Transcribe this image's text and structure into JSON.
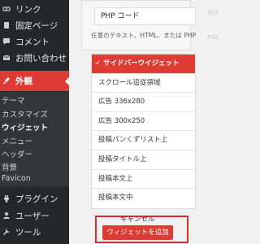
{
  "sidebar": {
    "items": [
      {
        "label": "リンク",
        "icon": "link-icon"
      },
      {
        "label": "固定ページ",
        "icon": "page-icon"
      },
      {
        "label": "コメント",
        "icon": "comment-icon"
      },
      {
        "label": "お問い合わせ",
        "icon": "mail-icon"
      },
      {
        "label": "外観",
        "icon": "brush-icon",
        "active": true
      },
      {
        "label": "プラグイン",
        "icon": "plugin-icon"
      },
      {
        "label": "ユーザー",
        "icon": "user-icon"
      },
      {
        "label": "ツール",
        "icon": "wrench-icon"
      }
    ],
    "submenu": [
      "テーマ",
      "カスタマイズ",
      "ウィジェット",
      "メニュー",
      "ヘッダー",
      "背景",
      "Favicon"
    ],
    "current_sub": "ウィジェット",
    "colors": {
      "bg": "#23282d",
      "submenu_bg": "#32373c",
      "active": "#dd3b34"
    }
  },
  "widget": {
    "field_value": "PHP コード",
    "description": "任意のテキスト、HTML、または PHP",
    "right_faded": [
      "RSS",
      "RSS"
    ]
  },
  "sidebar_choices": [
    "サイドバーウイジェット",
    "スクロール追従領域",
    "広告 336x280",
    "広告 300x250",
    "投稿パンくずリスト上",
    "投稿タイトル上",
    "投稿本文上",
    "投稿本文中"
  ],
  "selected_choice_index": 0,
  "actions": {
    "cancel": "キャンセル",
    "add": "ウィジェットを追加"
  },
  "accent_color": "#dd3b34"
}
